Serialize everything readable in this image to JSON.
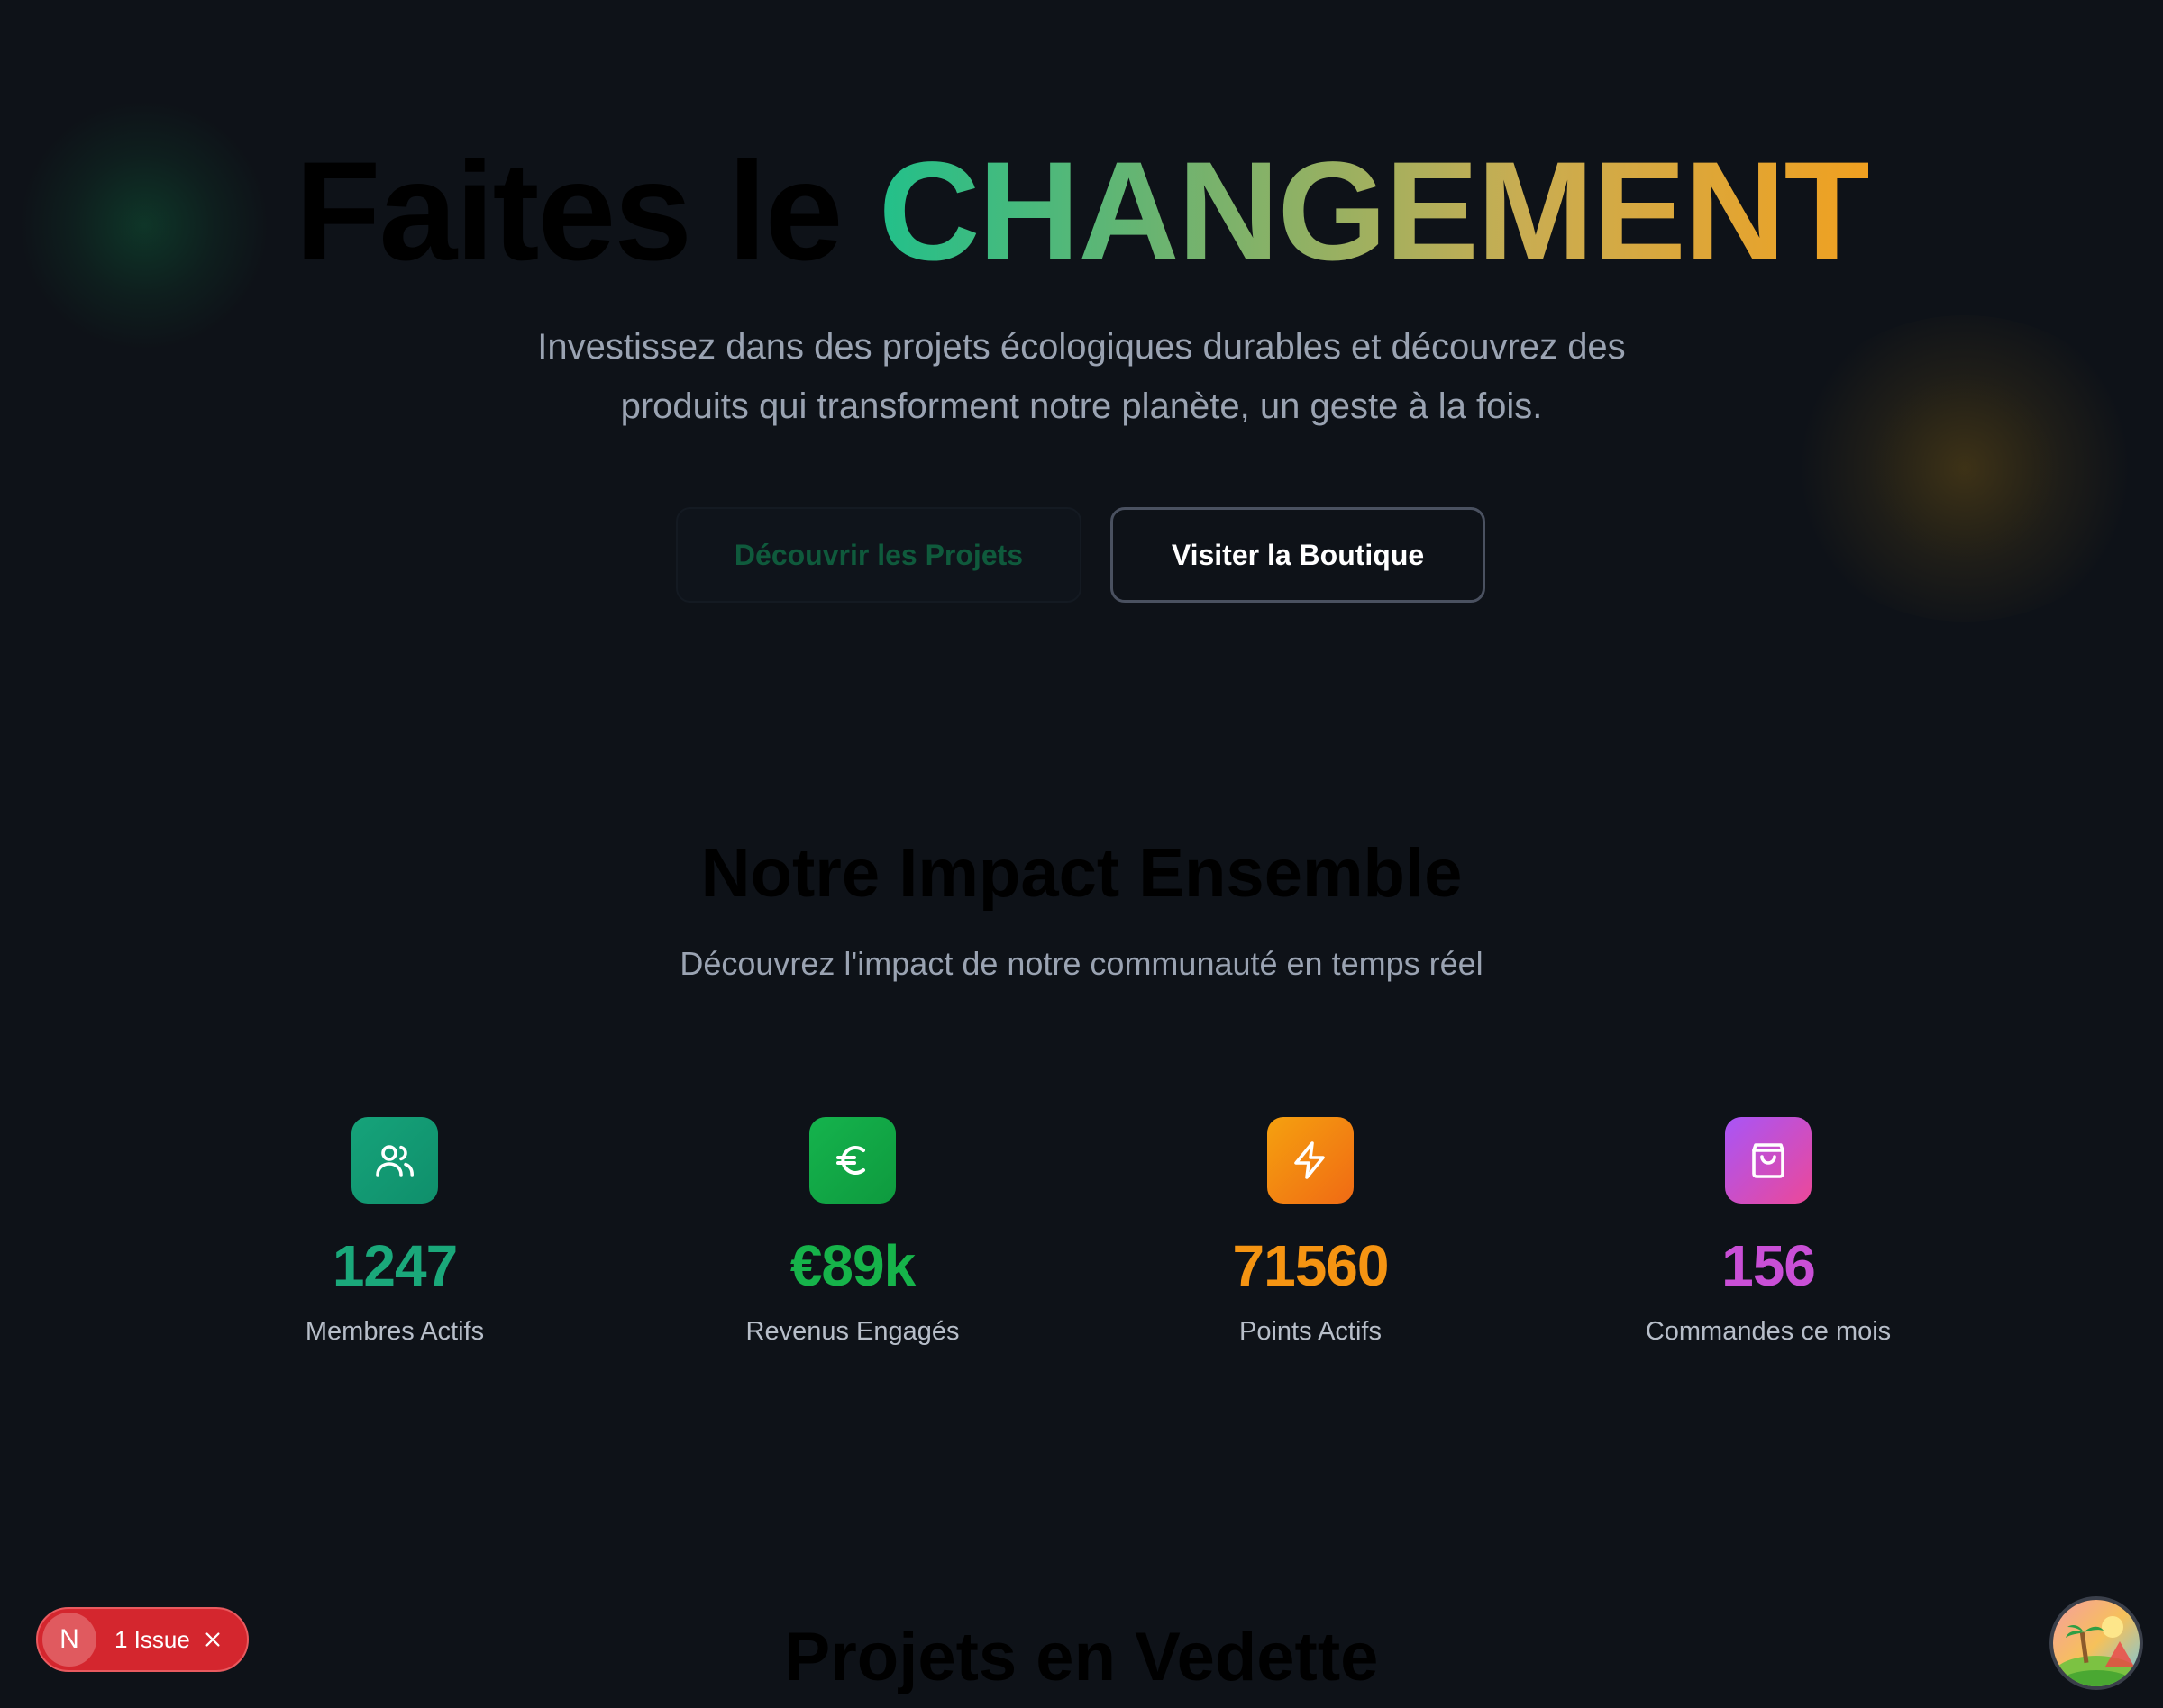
{
  "hero": {
    "title_plain": "Faites le",
    "title_highlight": "CHANGEMENT",
    "subtitle_line1": "Investissez dans des projets écologiques durables et découvrez des",
    "subtitle_line2": "produits qui transforment notre planète, un geste à la fois.",
    "primary_button": "Découvrir les Projets",
    "secondary_button": "Visiter la Boutique"
  },
  "impact": {
    "title": "Notre Impact Ensemble",
    "subtitle": "Découvrez l'impact de notre communauté en temps réel",
    "stats": [
      {
        "value": "1247",
        "label": "Membres Actifs",
        "icon": "users-icon",
        "color": "#1aa87a"
      },
      {
        "value": "€89k",
        "label": "Revenus Engagés",
        "icon": "euro-icon",
        "color": "#16b34a"
      },
      {
        "value": "71560",
        "label": "Points Actifs",
        "icon": "lightning-icon",
        "color": "#f59412"
      },
      {
        "value": "156",
        "label": "Commandes ce mois",
        "icon": "shopping-bag-icon",
        "color": "#c94fd6"
      }
    ]
  },
  "featured": {
    "title": "Projets en Vedette"
  },
  "dev_overlay": {
    "badge_letter": "N",
    "issues_label": "1 Issue"
  },
  "colors": {
    "background": "#0e1218",
    "gradient_start": "#22c08a",
    "gradient_end": "#f0a020"
  }
}
